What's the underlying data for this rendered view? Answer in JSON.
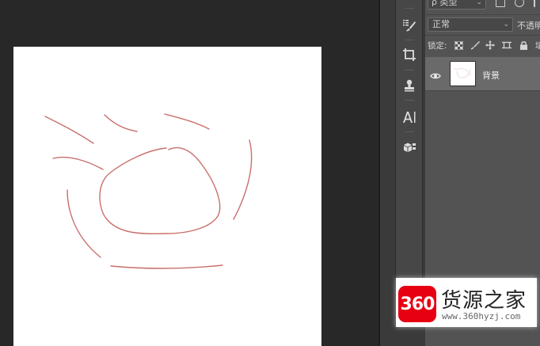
{
  "layers_panel": {
    "filter": {
      "kind_label": "ρ 类型"
    },
    "blend_mode": "正常",
    "opacity_label": "不透明",
    "lock_label": "锁定:",
    "fill_label": "填",
    "layers": [
      {
        "name": "背景",
        "visible": true
      }
    ]
  },
  "tools": [
    "history-brush-tool",
    "crop-tool",
    "stamp-tool",
    "type-tool",
    "3d-tool"
  ],
  "watermark": {
    "logo_text": "360",
    "title": "货源之家",
    "url": "www.360hyzj.com"
  },
  "colors": {
    "workspace_bg": "#282828",
    "panel_bg": "#535353",
    "toolstrip_bg": "#474747",
    "selected_layer_bg": "#6a6a6a",
    "sketch_stroke": "#c8706c",
    "brand_red": "#e60012"
  }
}
